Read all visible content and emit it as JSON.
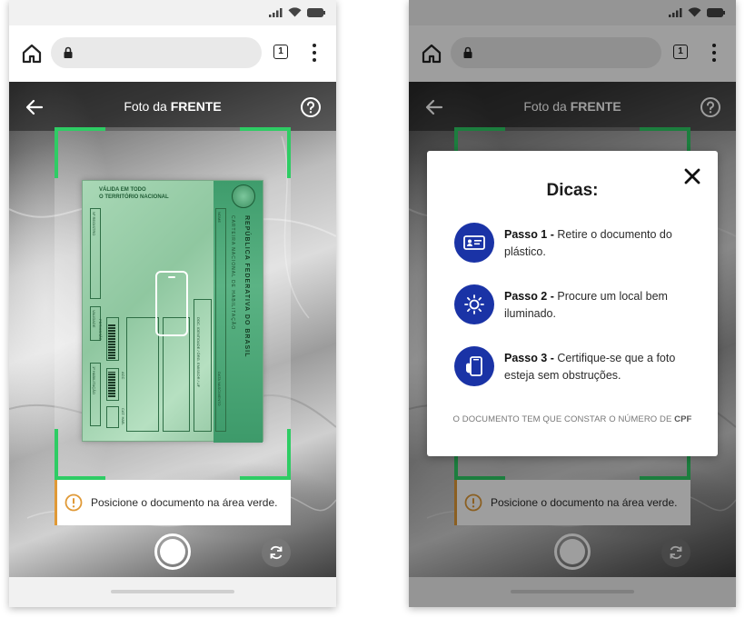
{
  "browser": {
    "tab_count": "1"
  },
  "camera": {
    "title_prefix": "Foto da",
    "title_bold": "FRENTE",
    "alert_text": "Posicione o documento na área verde."
  },
  "document": {
    "header_line1": "VÁLIDA EM TODO",
    "header_line2": "O TERRITÓRIO NACIONAL",
    "vertical_title": "REPÚBLICA FEDERATIVA DO BRASIL",
    "vertical_sub": "CARTEIRA NACIONAL DE HABILITAÇÃO",
    "field_registro": "Nº REGISTRO",
    "field_validade": "VALIDADE",
    "field_permissao": "PERMISSÃO",
    "field_habilitacao": "1ª HABILITAÇÃO",
    "field_acc": "ACC",
    "field_cat": "CAT. HAB.",
    "field_nome": "NOME",
    "field_doc": "DOC. IDENTIDADE / ÓRG. EMISSOR / UF",
    "field_nascimento": "DATA NASCIMENTO"
  },
  "modal": {
    "title": "Dicas:",
    "steps": [
      {
        "label": "Passo 1 -",
        "text": "Retire o documento do plástico.",
        "icon": "id-card-icon"
      },
      {
        "label": "Passo 2 -",
        "text": "Procure um local bem iluminado.",
        "icon": "sun-icon"
      },
      {
        "label": "Passo 3 -",
        "text": "Certifique-se que a foto esteja sem obstruções.",
        "icon": "phone-hand-icon"
      }
    ],
    "footer_text": "O DOCUMENTO TEM QUE CONSTAR O NÚMERO DE",
    "footer_bold": "CPF"
  },
  "colors": {
    "frame_green": "#2ecc64",
    "alert_orange": "#e09936",
    "step_blue": "#1a33a6"
  }
}
